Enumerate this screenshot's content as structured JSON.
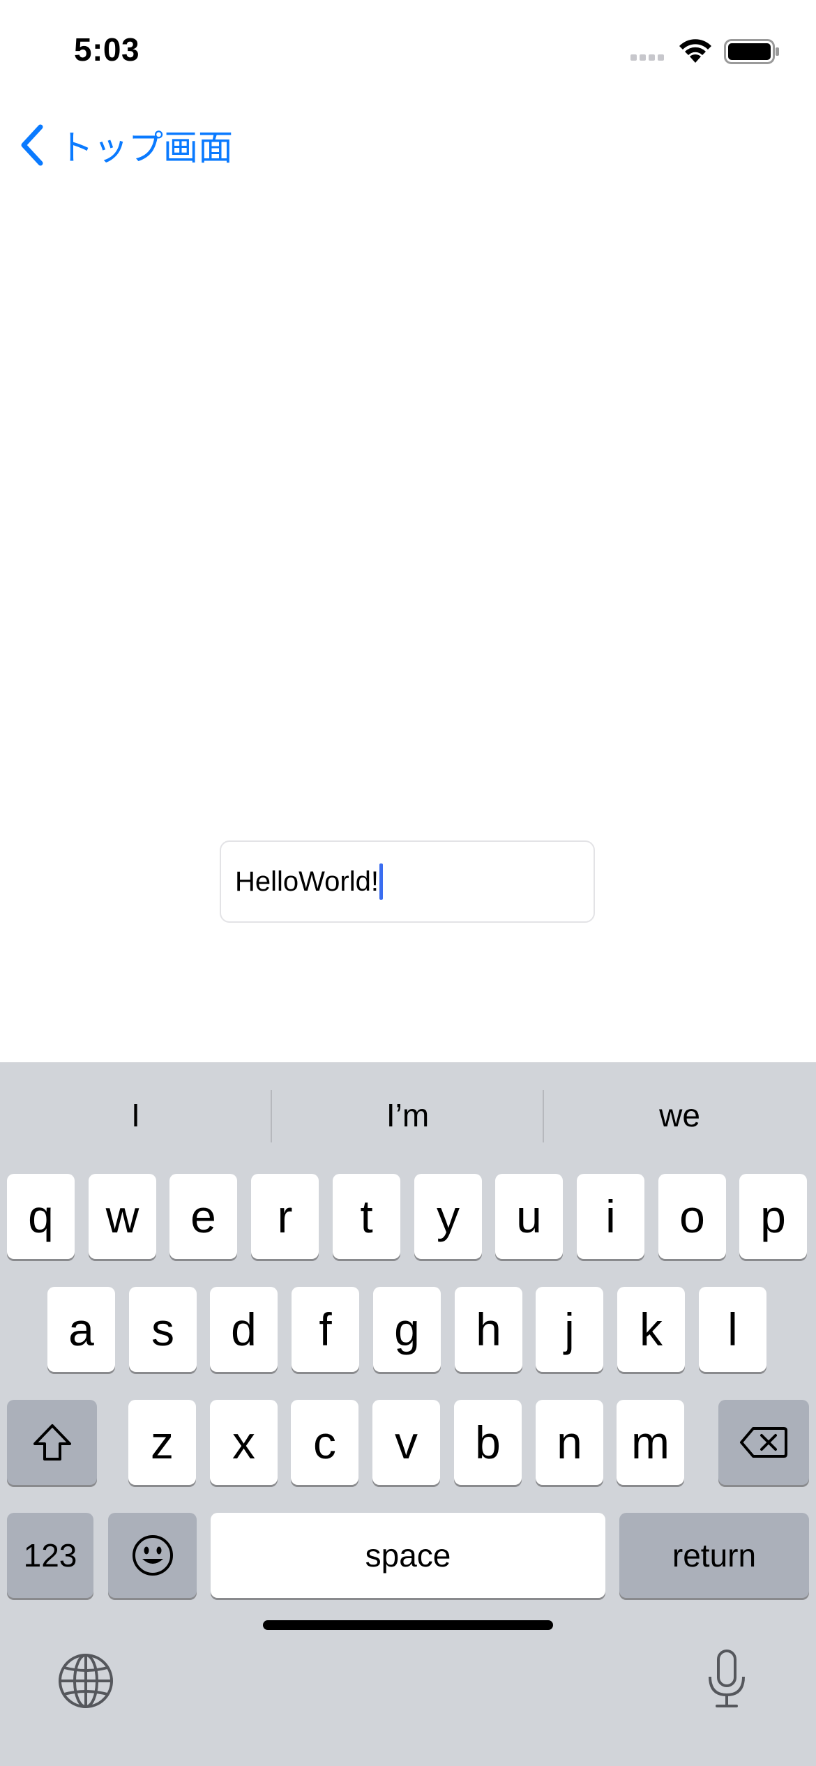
{
  "status": {
    "time": "5:03"
  },
  "nav": {
    "back_label": "トップ画面"
  },
  "text_field": {
    "value": "HelloWorld!"
  },
  "keyboard": {
    "suggestions": [
      "I",
      "I’m",
      "we"
    ],
    "row1": [
      "q",
      "w",
      "e",
      "r",
      "t",
      "y",
      "u",
      "i",
      "o",
      "p"
    ],
    "row2": [
      "a",
      "s",
      "d",
      "f",
      "g",
      "h",
      "j",
      "k",
      "l"
    ],
    "row3": [
      "z",
      "x",
      "c",
      "v",
      "b",
      "n",
      "m"
    ],
    "numbers_label": "123",
    "space_label": "space",
    "return_label": "return",
    "icons": {
      "shift": "shift-icon",
      "delete": "delete-icon",
      "emoji": "emoji-icon",
      "globe": "globe-icon",
      "mic": "microphone-icon"
    }
  },
  "colors": {
    "accent": "#0a7aff",
    "keyboard_bg": "#d1d4d9",
    "key_bg": "#ffffff",
    "special_key_bg": "#abb0ba",
    "caret": "#3a6df0"
  }
}
